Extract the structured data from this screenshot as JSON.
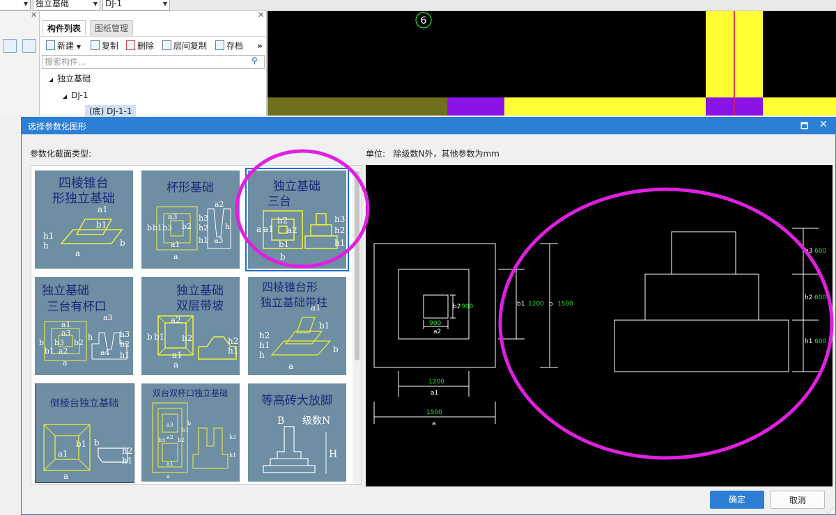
{
  "app": {
    "floor_select": "独立基础",
    "component_select": "DJ-1",
    "panel": {
      "tab_components": "构件列表",
      "tab_drawings": "图纸管理",
      "toolbar": {
        "new": "新建",
        "copy": "复制",
        "delete": "删除",
        "copy_floor": "层间复制",
        "archive": "存档",
        "more": "»"
      },
      "search_placeholder": "搜索构件...",
      "tree": {
        "root": "独立基础",
        "child": "DJ-1",
        "leaf": "(底) DJ-1-1"
      }
    },
    "canvas": {
      "axis_label": "6"
    }
  },
  "dialog": {
    "title": "选择参数化图形",
    "section_label": "参数化截面类型:",
    "unit_label": "单位:",
    "unit_text": "除级数N外，其他参数为mm",
    "ok": "确定",
    "cancel": "取消",
    "thumbnails": [
      {
        "line1": "四棱锥台",
        "line2": "形独立基础",
        "labels": [
          "a1",
          "b1",
          "h1",
          "h",
          "b",
          "a"
        ]
      },
      {
        "line1": "杯形基础",
        "line2": "",
        "labels": [
          "a2",
          "a3",
          "b2",
          "h3",
          "h2",
          "h1",
          "h",
          "a1",
          "a",
          "a3",
          "b",
          "b1",
          "b3"
        ]
      },
      {
        "line1": "独立基础",
        "line2": "三台",
        "labels": [
          "a",
          "a1",
          "b2",
          "a2",
          "b1",
          "b",
          "h3",
          "h2",
          "h1"
        ]
      },
      {
        "line1": "独立基础",
        "line2": "三台有杯口",
        "labels": [
          "a1",
          "a3",
          "b3",
          "b2",
          "a2",
          "a",
          "b",
          "b1",
          "h",
          "a3",
          "a4",
          "h3",
          "h2",
          "h1"
        ]
      },
      {
        "line1": "独立基础",
        "line2": "双层带坡",
        "labels": [
          "a2",
          "b",
          "b1",
          "b2",
          "a1",
          "a",
          "h2",
          "h1"
        ]
      },
      {
        "line1": "四棱锥台形",
        "line2": "独立基础带柱",
        "labels": [
          "a1",
          "b1",
          "h2",
          "h1",
          "h",
          "b",
          "a"
        ]
      },
      {
        "line1": "倒棱台独立基础",
        "line2": "",
        "labels": [
          "b1",
          "a1",
          "b",
          "h2",
          "h1",
          "a"
        ]
      },
      {
        "line1": "双台双杯口独立基础",
        "line2": "",
        "labels": [
          "a3",
          "a2",
          "a1",
          "b3",
          "b2",
          "b1",
          "b",
          "a",
          "h2",
          "h1"
        ]
      },
      {
        "line1": "等高砖大放脚",
        "line2": "",
        "labels": [
          "B",
          "级数N",
          "H"
        ]
      }
    ],
    "preview": {
      "plan": {
        "b2": "b2",
        "b2_val": "900",
        "a2_val": "900",
        "a2": "a2",
        "b1": "b1",
        "b1_val": "1200",
        "b": "b",
        "b_val": "1500",
        "a1_val": "1200",
        "a1": "a1",
        "a_val": "1500",
        "a": "a"
      },
      "elevation": {
        "h3": "h3",
        "h3_val": "600",
        "h2": "h2",
        "h2_val": "600",
        "h1": "h1",
        "h1_val": "600"
      }
    }
  },
  "colors": {
    "title_bar": "#2d7fd6",
    "thumb_bg": "#6d8ea3",
    "thumb_title": "#1a2a7a",
    "thumb_line": "#f2f23a",
    "annotation_magenta": "#e020e0",
    "dim_green": "#2fe02f",
    "canvas_yellow": "#ffff33",
    "canvas_purple": "#8a14e8",
    "canvas_olive": "#6f6f1e"
  }
}
